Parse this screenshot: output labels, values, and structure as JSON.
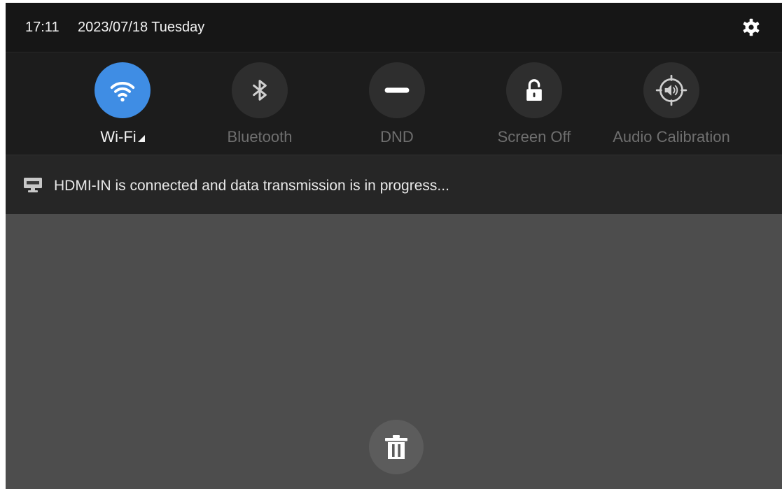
{
  "status_bar": {
    "time": "17:11",
    "date": "2023/07/18 Tuesday",
    "settings_icon": "gear-icon"
  },
  "quick_settings": [
    {
      "id": "wifi",
      "label": "Wi-Fi",
      "icon": "wifi-icon",
      "active": true
    },
    {
      "id": "bluetooth",
      "label": "Bluetooth",
      "icon": "bluetooth-icon",
      "active": false
    },
    {
      "id": "dnd",
      "label": "DND",
      "icon": "dnd-icon",
      "active": false
    },
    {
      "id": "screen-off",
      "label": "Screen Off",
      "icon": "lock-icon",
      "active": false
    },
    {
      "id": "audio-calibration",
      "label": "Audio Calibration",
      "icon": "audio-calibration-icon",
      "active": false
    }
  ],
  "notification": {
    "icon": "hdmi-icon",
    "text": "HDMI-IN is connected and data transmission is in progress..."
  },
  "clear_button": {
    "icon": "trash-icon"
  },
  "colors": {
    "accent": "#3f8de4",
    "status_bg": "#161616",
    "panel_bg": "#1c1c1c",
    "notification_bg": "#262626",
    "shade_bg": "#4d4d4d"
  }
}
